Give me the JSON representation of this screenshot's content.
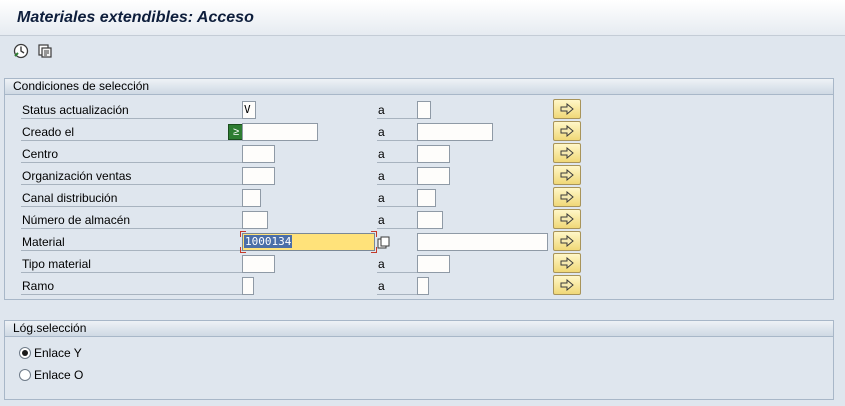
{
  "window": {
    "title": "Materiales extendibles: Acceso"
  },
  "toolbar": {
    "buttons": [
      {
        "name": "execute-icon"
      },
      {
        "name": "variant-icon"
      }
    ]
  },
  "selection_group": {
    "title": "Condiciones de selección",
    "to_label": "a",
    "rows": [
      {
        "label": "Status actualización",
        "from": "V",
        "to": ""
      },
      {
        "label": "Creado el",
        "from": "",
        "to": "",
        "option_icon": "≥"
      },
      {
        "label": "Centro",
        "from": "",
        "to": ""
      },
      {
        "label": "Organización ventas",
        "from": "",
        "to": ""
      },
      {
        "label": "Canal distribución",
        "from": "",
        "to": ""
      },
      {
        "label": "Número de almacén",
        "from": "",
        "to": ""
      },
      {
        "label": "Material",
        "from": "1000134",
        "to": ""
      },
      {
        "label": "Tipo material",
        "from": "",
        "to": ""
      },
      {
        "label": "Ramo",
        "from": "",
        "to": ""
      }
    ]
  },
  "logic_group": {
    "title": "Lóg.selección",
    "options": [
      {
        "label": "Enlace Y",
        "selected": true
      },
      {
        "label": "Enlace O",
        "selected": false
      }
    ]
  },
  "colors": {
    "background": "#dfe6ee",
    "active_field": "#ffe27a",
    "arrow_button": "#f0d878"
  }
}
